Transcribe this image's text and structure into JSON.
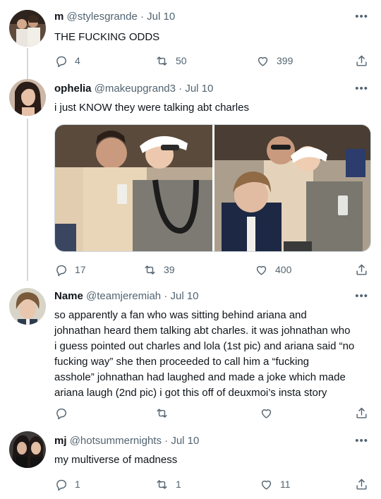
{
  "tweets": [
    {
      "name": "m",
      "handle": "@stylesgrande",
      "date": "Jul 10",
      "text": "THE FUCKING ODDS",
      "replies": "4",
      "retweets": "50",
      "likes": "399"
    },
    {
      "name": "ophelia",
      "handle": "@makeupgrand3",
      "date": "Jul 10",
      "text": "i just KNOW they were talking abt  charles",
      "replies": "17",
      "retweets": "39",
      "likes": "400"
    },
    {
      "name": "Name",
      "handle": "@teamjeremiah",
      "date": "Jul 10",
      "text_lines": [
        "so apparently a fan who was sitting behind  ariana and",
        "johnathan heard them talking abt charles. it was johnathan who",
        "i guess pointed out charles and lola (1st pic) and ariana said “no",
        "fucking way” she then proceeded to call him a “fucking",
        "asshole” johnathan had laughed and made a joke which made",
        "ariana laugh (2nd pic) i got this off of deuxmoi’s insta story"
      ],
      "replies": "",
      "retweets": "",
      "likes": ""
    },
    {
      "name": "mj",
      "handle": "@hotsummernights",
      "date": "Jul 10",
      "text": "my multiverse of madness",
      "replies": "1",
      "retweets": "1",
      "likes": "11"
    }
  ],
  "separator": "·",
  "more_glyph": "•••",
  "icons": [
    "reply-icon",
    "retweet-icon",
    "like-icon",
    "share-icon",
    "more-icon"
  ],
  "colors": {
    "text": "#0f1419",
    "secondary": "#536471",
    "line": "#cfd9de"
  }
}
